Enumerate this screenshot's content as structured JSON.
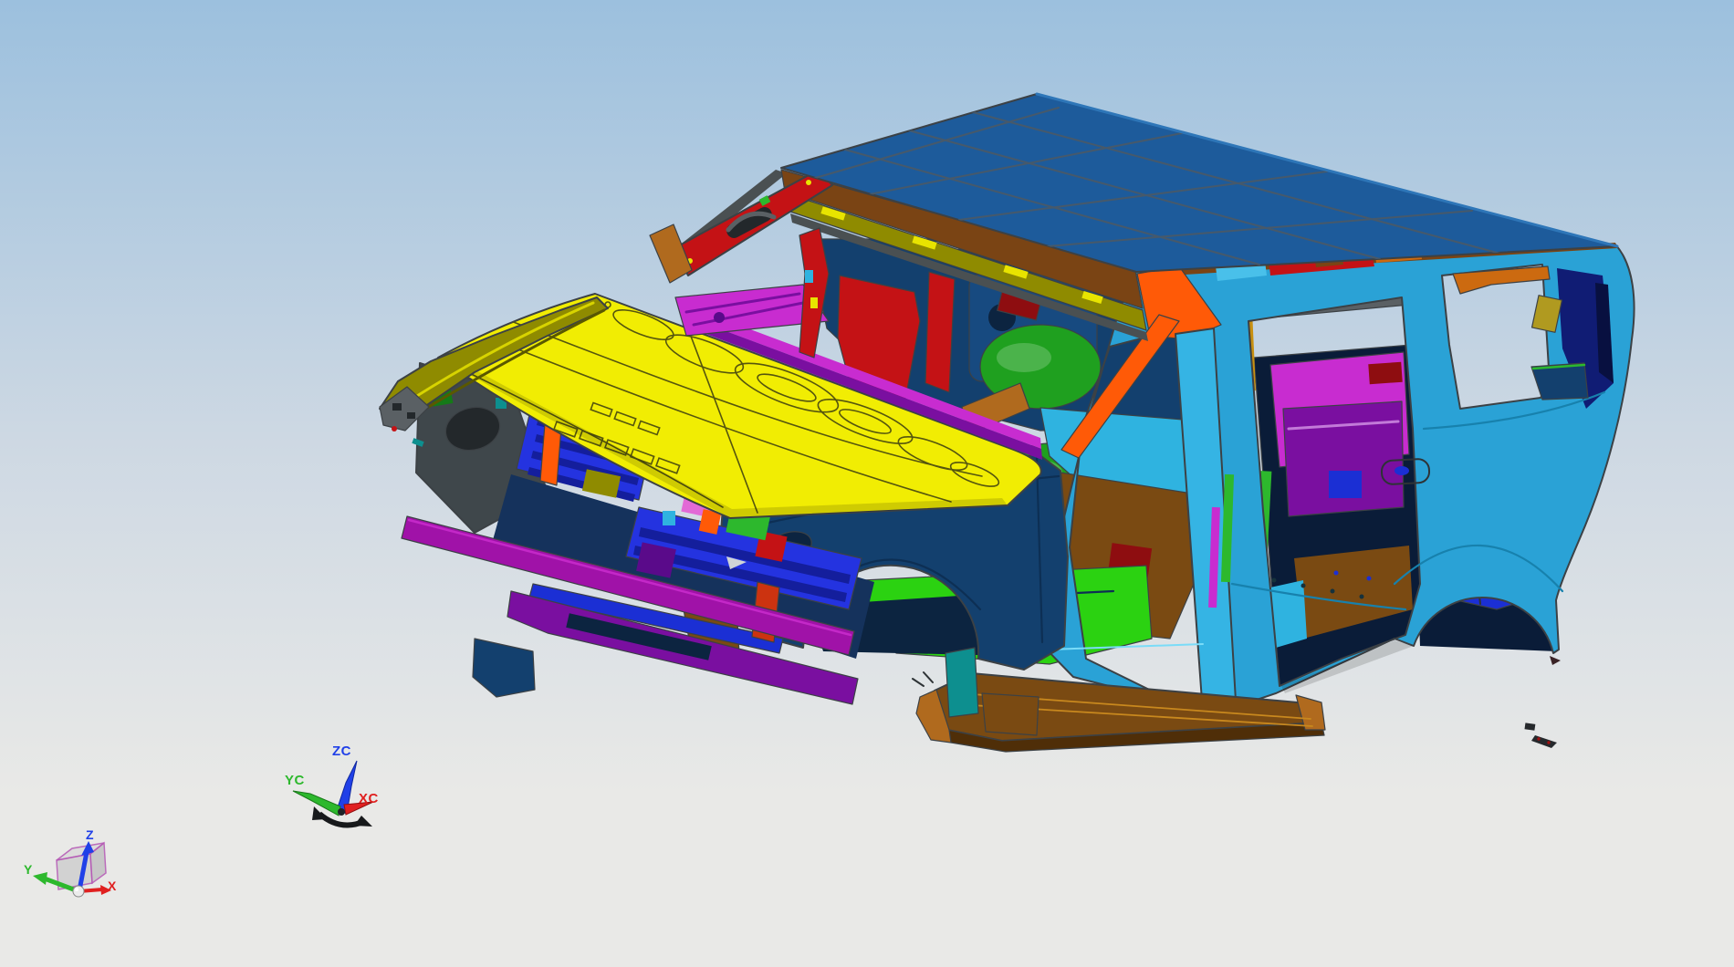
{
  "scene": {
    "type": "cad-3d-viewport",
    "model": "suv-body-in-white"
  },
  "colors": {
    "bg_top": "#9cc0de",
    "bg_mid": "#cdd8e3",
    "bg_bottom": "#e9e9e7",
    "hood_yellow": "#f1ed03",
    "olive": "#8f8b00",
    "yellow_hi": "#e8e400",
    "roof_blue": "#1d5b9b",
    "bodyside_cyan": "#2aa2d6",
    "bodyside_light": "#49c0ea",
    "pillar_cyan": "#35b4e4",
    "cyan_floor": "#2fb3e0",
    "navy": "#13406e",
    "navy_mid": "#174a80",
    "navy_dark": "#0c2440",
    "navy_deep": "#0a1c38",
    "indigo": "#101c74",
    "indigo_dark": "#081040",
    "steel_blue": "#15325c",
    "royal_blue": "#1b2fd4",
    "grille_blue": "#2433e0",
    "slat_blue": "#141e9c",
    "green_bright": "#2bd211",
    "green_seat": "#1fa01f",
    "green_mid": "#2db82d",
    "green_dark": "#157a18",
    "teal": "#0d8f8f",
    "magenta": "#c82cd0",
    "magenta_deep": "#a012a8",
    "purple": "#7a0fa0",
    "violet": "#5a0a8a",
    "pink": "#e26ad6",
    "red": "#c41215",
    "red_dark": "#8e0d10",
    "red_orange": "#cc3310",
    "orange": "#ff5a07",
    "orange_amber": "#cc6a10",
    "header_brown": "#7a4414",
    "brown": "#7a4a12",
    "brown_dark": "#4f2e08",
    "copper": "#b06a1e",
    "amber": "#c89010",
    "gold_olive": "#b09a20",
    "slate": "#3f474b",
    "gray": "#5a6064",
    "gray_dark": "#4a5052",
    "gray_light": "#cfd4d6",
    "char": "#23282b",
    "dark_part": "#26292c",
    "wcs_blue": "#2040e8",
    "wcs_green": "#2db82d",
    "wcs_red": "#e02020",
    "datum_magenta": "#b45ab4",
    "sphere": "#ececec"
  },
  "wcs": {
    "z_label": "ZC",
    "y_label": "YC",
    "x_label": "XC"
  },
  "datum": {
    "z_label": "Z",
    "y_label": "Y",
    "x_label": "X"
  },
  "parts_legend": [
    {
      "part": "hood-panel",
      "color_key": "hood_yellow"
    },
    {
      "part": "roof-panel",
      "color_key": "roof_blue"
    },
    {
      "part": "rear-bodyside-panel",
      "color_key": "bodyside_cyan"
    },
    {
      "part": "front-fender-apron",
      "color_key": "navy"
    },
    {
      "part": "floor-pan",
      "color_key": "green_bright"
    },
    {
      "part": "seat-structures",
      "color_key": "green_seat"
    },
    {
      "part": "cowl-and-sill-trim",
      "color_key": "magenta"
    },
    {
      "part": "a-pillar-brace",
      "color_key": "orange"
    },
    {
      "part": "windshield-header",
      "color_key": "red"
    },
    {
      "part": "radiator-grille",
      "color_key": "grille_blue"
    },
    {
      "part": "bumper-beam",
      "color_key": "magenta_deep"
    },
    {
      "part": "running-board",
      "color_key": "brown"
    },
    {
      "part": "roof-front-header",
      "color_key": "header_brown"
    },
    {
      "part": "left-fender-rail",
      "color_key": "olive"
    }
  ]
}
